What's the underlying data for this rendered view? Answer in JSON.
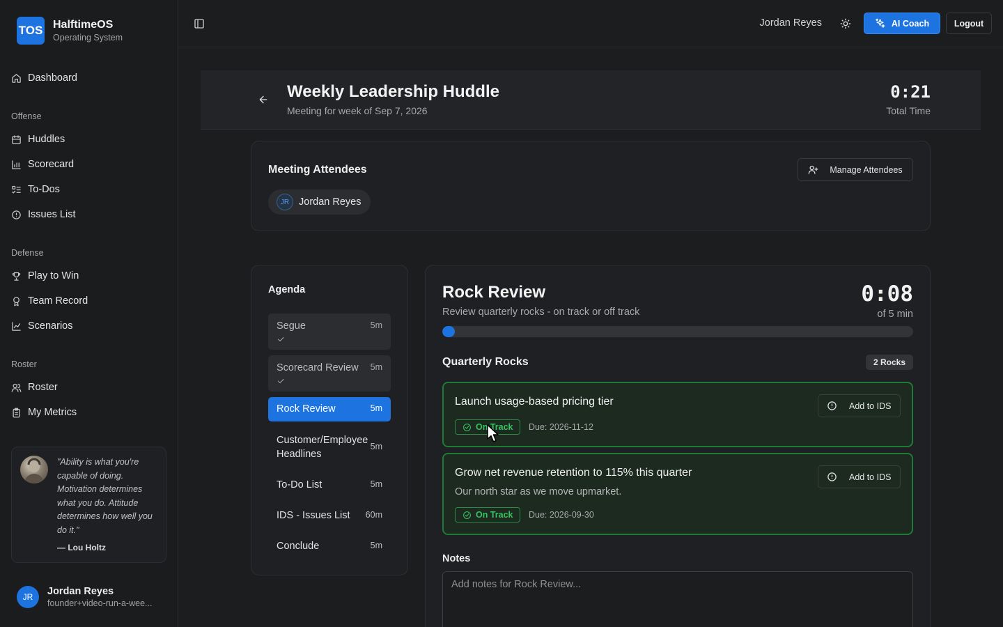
{
  "brand": {
    "logo": "TOS",
    "name": "HalftimeOS",
    "subtitle": "Operating System"
  },
  "sidebar": {
    "dashboard": "Dashboard",
    "offense": {
      "heading": "Offense",
      "items": [
        {
          "label": "Huddles",
          "icon": "calendar-icon"
        },
        {
          "label": "Scorecard",
          "icon": "bar-chart-icon"
        },
        {
          "label": "To-Dos",
          "icon": "list-todo-icon"
        },
        {
          "label": "Issues List",
          "icon": "alert-circle-icon"
        }
      ]
    },
    "defense": {
      "heading": "Defense",
      "items": [
        {
          "label": "Play to Win",
          "icon": "trophy-icon"
        },
        {
          "label": "Team Record",
          "icon": "award-icon"
        },
        {
          "label": "Scenarios",
          "icon": "line-chart-icon"
        }
      ]
    },
    "roster": {
      "heading": "Roster",
      "items": [
        {
          "label": "Roster",
          "icon": "users-icon"
        },
        {
          "label": "My Metrics",
          "icon": "clipboard-icon"
        }
      ]
    },
    "quote": {
      "text": "\"Ability is what you're capable of doing. Motivation determines what you do. Attitude determines how well you do it.\"",
      "author": "— Lou Holtz"
    },
    "user": {
      "initials": "JR",
      "name": "Jordan Reyes",
      "email": "founder+video-run-a-wee..."
    }
  },
  "topbar": {
    "user_name": "Jordan Reyes",
    "ai_coach": "AI Coach",
    "logout": "Logout"
  },
  "meeting": {
    "title": "Weekly Leadership Huddle",
    "subtitle": "Meeting for week of Sep 7, 2026",
    "total_time": "0:21",
    "total_time_label": "Total Time"
  },
  "attendees": {
    "title": "Meeting Attendees",
    "manage": "Manage Attendees",
    "list": [
      {
        "initials": "JR",
        "name": "Jordan Reyes"
      }
    ]
  },
  "agenda": {
    "title": "Agenda",
    "items": [
      {
        "label": "Segue",
        "duration": "5m",
        "state": "done"
      },
      {
        "label": "Scorecard Review",
        "duration": "5m",
        "state": "done"
      },
      {
        "label": "Rock Review",
        "duration": "5m",
        "state": "active"
      },
      {
        "label": "Customer/Employee Headlines",
        "duration": "5m",
        "state": "pending"
      },
      {
        "label": "To-Do List",
        "duration": "5m",
        "state": "pending"
      },
      {
        "label": "IDS - Issues List",
        "duration": "60m",
        "state": "pending"
      },
      {
        "label": "Conclude",
        "duration": "5m",
        "state": "pending"
      }
    ]
  },
  "section": {
    "title": "Rock Review",
    "subtitle": "Review quarterly rocks - on track or off track",
    "timer": "0:08",
    "timer_of": "of 5 min",
    "progress": 0.027,
    "rocks_title": "Quarterly Rocks",
    "rocks_count": "2 Rocks",
    "add_to_ids": "Add to IDS",
    "rocks": [
      {
        "title": "Launch usage-based pricing tier",
        "description": "",
        "status": "On Track",
        "due": "Due: 2026-11-12"
      },
      {
        "title": "Grow net revenue retention to 115% this quarter",
        "description": "Our north star as we move upmarket.",
        "status": "On Track",
        "due": "Due: 2026-09-30"
      }
    ],
    "notes_label": "Notes",
    "notes_placeholder": "Add notes for Rock Review..."
  },
  "colors": {
    "accent": "#1d74e0",
    "on_track": "#35c35e",
    "rock_border": "#1f7a35"
  }
}
